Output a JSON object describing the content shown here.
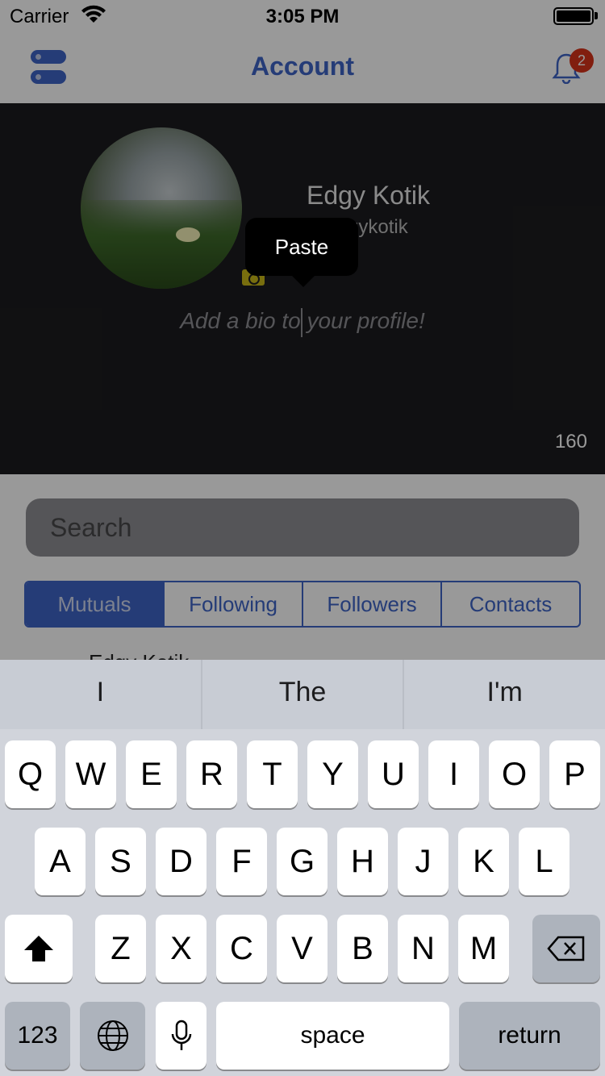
{
  "status_bar": {
    "carrier": "Carrier",
    "time": "3:05 PM"
  },
  "nav": {
    "title": "Account",
    "notification_count": "2"
  },
  "profile": {
    "name": "Edgy Kotik",
    "handle": "@edgykotik",
    "bio_placeholder": "Add a bio to your profile!",
    "char_count": "160",
    "paste_label": "Paste"
  },
  "search": {
    "placeholder": "Search"
  },
  "segments": [
    "Mutuals",
    "Following",
    "Followers",
    "Contacts"
  ],
  "list_peek": "Edgy Kotik",
  "keyboard": {
    "predictions": [
      "I",
      "The",
      "I'm"
    ],
    "row1": [
      "Q",
      "W",
      "E",
      "R",
      "T",
      "Y",
      "U",
      "I",
      "O",
      "P"
    ],
    "row2": [
      "A",
      "S",
      "D",
      "F",
      "G",
      "H",
      "J",
      "K",
      "L"
    ],
    "row3": [
      "Z",
      "X",
      "C",
      "V",
      "B",
      "N",
      "M"
    ],
    "numbers_label": "123",
    "space_label": "space",
    "return_label": "return"
  },
  "colors": {
    "accent": "#3f64c6",
    "badge": "#d8321a",
    "header_bg": "#1c1c1e"
  }
}
